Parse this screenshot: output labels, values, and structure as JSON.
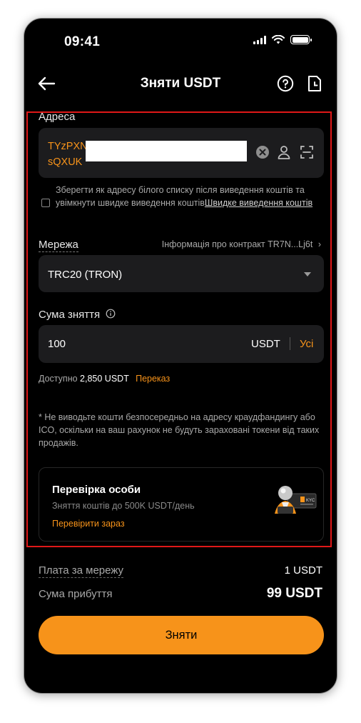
{
  "status": {
    "time": "09:41"
  },
  "header": {
    "title": "Зняти USDT"
  },
  "address": {
    "label": "Адреса",
    "line1": "TYzPXN",
    "line2": "sQXUK"
  },
  "whitelist": {
    "text": "Зберегти як адресу білого списку після виведення коштів та увімкнути швидке виведення коштів",
    "link": "Швидке виведення коштів"
  },
  "network": {
    "label": "Мережа",
    "contract_info": "Інформація про контракт TR7N...Lj6t",
    "selected": "TRC20 (TRON)"
  },
  "amount": {
    "label": "Сума зняття",
    "value": "100",
    "unit": "USDT",
    "max_label": "Усі"
  },
  "available": {
    "prefix": "Доступно",
    "value": "2,850 USDT",
    "transfer_label": "Переказ"
  },
  "warning": "* Не виводьте кошти безпосередньо на адресу краудфандингу або ICO, оскільки на ваш рахунок не будуть зараховані токени від таких продажів.",
  "kyc": {
    "title": "Перевірка особи",
    "subtitle": "Зняття коштів до 500K USDT/день",
    "link": "Перевірити зараз",
    "badge": "KYC"
  },
  "summary": {
    "fee_label": "Плата за мережу",
    "fee_value": "1 USDT",
    "arrival_label": "Сума прибуття",
    "arrival_value": "99 USDT"
  },
  "submit_label": "Зняти",
  "colors": {
    "accent": "#f7931a",
    "highlight_border": "#e01818",
    "field_bg": "#1c1c1e"
  }
}
